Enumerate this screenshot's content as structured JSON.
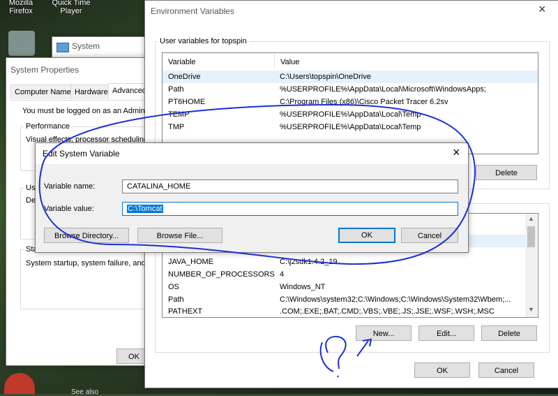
{
  "desktop": {
    "icons": [
      {
        "label": "Mozilla\nFirefox"
      },
      {
        "label": "Quick Time\nPlayer"
      }
    ],
    "bottom_text": "See also"
  },
  "system_window": {
    "title": "System"
  },
  "system_properties": {
    "title": "System Properties",
    "tabs": [
      "Computer Name",
      "Hardware",
      "Advanced"
    ],
    "admin_notice": "You must be logged on as an Administrat",
    "performance_title": "Performance",
    "performance_text": "Visual effects, processor scheduling, m",
    "user_profiles_title": "Use",
    "user_profiles_text": "De",
    "startup_title": "Star",
    "startup_text": "System startup, system failure, and deb",
    "ok_label": "OK"
  },
  "env_vars": {
    "title": "Environment Variables",
    "user_section_title": "User variables for topspin",
    "columns": [
      "Variable",
      "Value"
    ],
    "user_rows": [
      {
        "variable": "OneDrive",
        "value": "C:\\Users\\topspin\\OneDrive"
      },
      {
        "variable": "Path",
        "value": "%USERPROFILE%\\AppData\\Local\\Microsoft\\WindowsApps;"
      },
      {
        "variable": "PT6HOME",
        "value": "C:\\Program Files (x86)\\Cisco Packet Tracer 6.2sv"
      },
      {
        "variable": "TEMP",
        "value": "%USERPROFILE%\\AppData\\Local\\Temp"
      },
      {
        "variable": "TMP",
        "value": "%USERPROFILE%\\AppData\\Local\\Temp"
      }
    ],
    "user_delete_label": "Delete",
    "system_rows": [
      {
        "variable": "JAVA_HOME",
        "value": "C:\\j2sdk1.4.2_19"
      },
      {
        "variable": "NUMBER_OF_PROCESSORS",
        "value": "4"
      },
      {
        "variable": "OS",
        "value": "Windows_NT"
      },
      {
        "variable": "Path",
        "value": "C:\\Windows\\system32;C:\\Windows;C:\\Windows\\System32\\Wbem;..."
      },
      {
        "variable": "PATHEXT",
        "value": ".COM;.EXE;.BAT;.CMD;.VBS;.VBE;.JS;.JSE;.WSF;.WSH;.MSC"
      }
    ],
    "new_label": "New...",
    "edit_label": "Edit...",
    "delete_label": "Delete",
    "ok_label": "OK",
    "cancel_label": "Cancel"
  },
  "edit_dialog": {
    "title": "Edit System Variable",
    "name_label": "Variable name:",
    "name_value": "CATALINA_HOME",
    "value_label": "Variable value:",
    "value_value": "C:\\Tomcat",
    "browse_directory_label": "Browse Directory...",
    "browse_file_label": "Browse File...",
    "ok_label": "OK",
    "cancel_label": "Cancel"
  },
  "annotation": {
    "color": "#1a2fd6",
    "scribble": "?"
  }
}
